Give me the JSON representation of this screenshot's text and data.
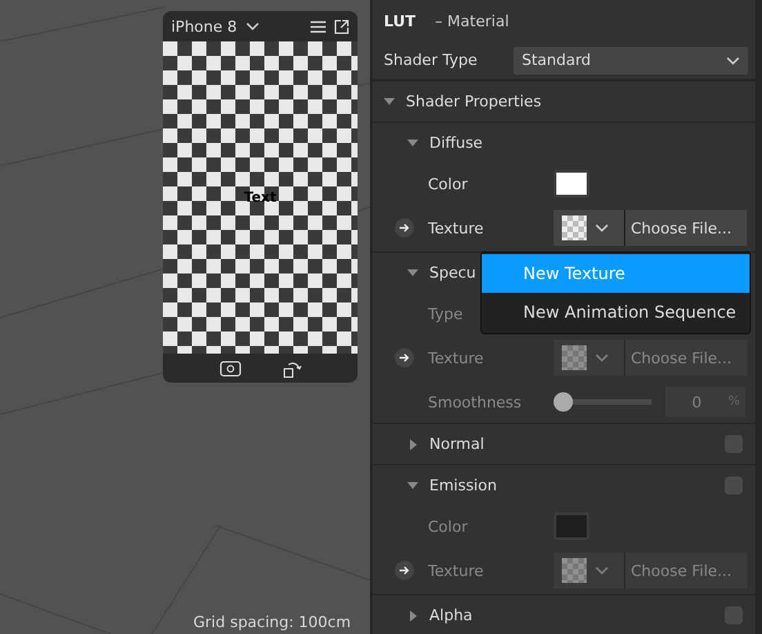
{
  "viewport": {
    "grid_label": "Grid spacing: 100cm"
  },
  "preview": {
    "device": "iPhone 8",
    "canvas_text": "Text"
  },
  "inspector": {
    "name": "LUT",
    "type": "– Material",
    "shader_type": {
      "label": "Shader Type",
      "value": "Standard"
    },
    "sections": [
      {
        "kind": "group",
        "label": "Shader Properties",
        "expanded": true,
        "children": [
          {
            "kind": "group",
            "label": "Diffuse",
            "expanded": true,
            "children": [
              {
                "kind": "color",
                "label": "Color",
                "color": "#ffffff",
                "disabled": false
              },
              {
                "kind": "texture",
                "label": "Texture",
                "button": "Choose File...",
                "disabled": false
              }
            ]
          },
          {
            "kind": "group",
            "label": "Specu",
            "expanded": true,
            "children": [
              {
                "kind": "select",
                "label": "Type",
                "disabled": true
              },
              {
                "kind": "texture",
                "label": "Texture",
                "button": "Choose File...",
                "disabled": true
              },
              {
                "kind": "slider",
                "label": "Smoothness",
                "level": 0,
                "reading": "0",
                "unit": "%",
                "disabled": true
              }
            ]
          },
          {
            "kind": "group",
            "label": "Normal",
            "expanded": false,
            "checked": false
          },
          {
            "kind": "group",
            "label": "Emission",
            "expanded": true,
            "checked": false,
            "children": [
              {
                "kind": "color",
                "label": "Color",
                "color": "#1e1e1e",
                "disabled": true
              },
              {
                "kind": "texture",
                "label": "Texture",
                "button": "Choose File...",
                "disabled": true
              }
            ]
          },
          {
            "kind": "group",
            "label": "Alpha",
            "expanded": false,
            "checked": false
          }
        ]
      }
    ]
  },
  "menu": {
    "items": [
      {
        "label": "New Texture",
        "selected": true
      },
      {
        "label": "New Animation Sequence",
        "selected": false
      }
    ]
  }
}
